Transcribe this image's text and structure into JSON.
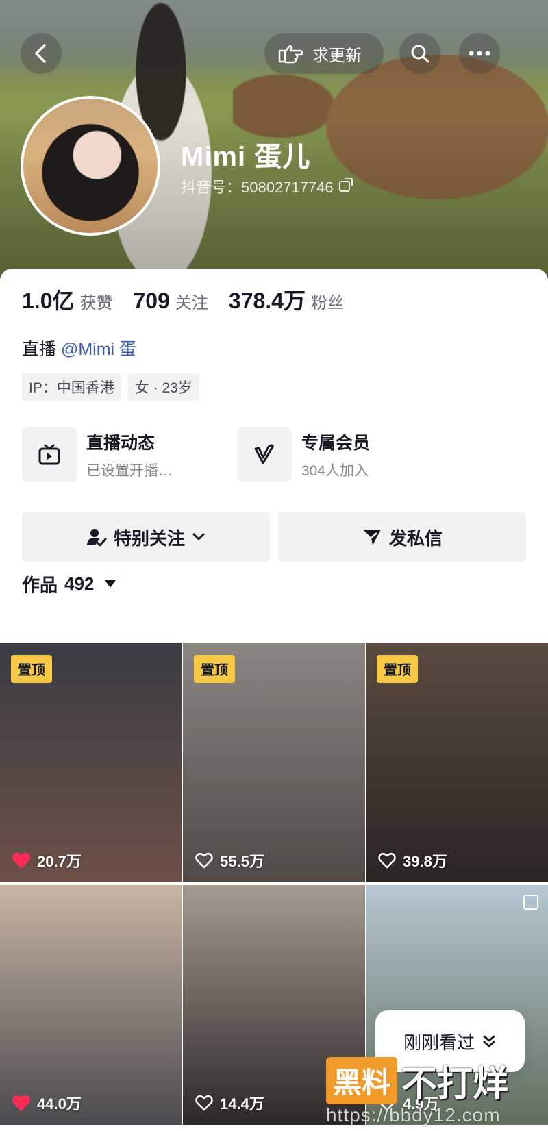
{
  "header": {
    "update_label": "求更新"
  },
  "profile": {
    "name": "Mimi 蛋儿",
    "douyin_id": "抖音号：50802717746"
  },
  "stats": [
    {
      "num": "1.0亿",
      "label": "获赞"
    },
    {
      "num": "709",
      "label": "关注"
    },
    {
      "num": "378.4万",
      "label": "粉丝"
    }
  ],
  "bio": {
    "prefix": "直播 ",
    "mention": "@Mimi 蛋"
  },
  "tags": [
    "IP：中国香港",
    "女 · 23岁"
  ],
  "features": {
    "live": {
      "title": "直播动态",
      "sub": "已设置开播…"
    },
    "member": {
      "title": "专属会员",
      "sub": "304人加入"
    }
  },
  "actions": {
    "follow": "特别关注",
    "message": "发私信"
  },
  "works": {
    "label": "作品",
    "count": "492"
  },
  "grid": [
    {
      "pinned": "置顶",
      "likes": "20.7万",
      "liked": true,
      "colors": [
        "#3a3c44",
        "#6d5046"
      ]
    },
    {
      "pinned": "置顶",
      "likes": "55.5万",
      "liked": false,
      "colors": [
        "#8b8681",
        "#4f4a45"
      ]
    },
    {
      "pinned": "置顶",
      "likes": "39.8万",
      "liked": false,
      "colors": [
        "#5b4a40",
        "#2a2523"
      ]
    },
    {
      "pinned": "",
      "likes": "44.0万",
      "liked": true,
      "colors": [
        "#c9b4a3",
        "#4b4a4e"
      ]
    },
    {
      "pinned": "",
      "likes": "14.4万",
      "liked": false,
      "colors": [
        "#a79a90",
        "#2b2828"
      ]
    },
    {
      "pinned": "",
      "likes": "4.9万",
      "liked": false,
      "colors": [
        "#b7c7d4",
        "#5f6e5b"
      ]
    }
  ],
  "recent_label": "刚刚看过",
  "watermark": {
    "badge": "黑料",
    "text": "不打烊",
    "url": "https://bbdy12.com"
  },
  "colors": {
    "pin_yellow": "#f6c844",
    "heart_red": "#fe2c55",
    "mention_blue": "#3a5bb5"
  }
}
